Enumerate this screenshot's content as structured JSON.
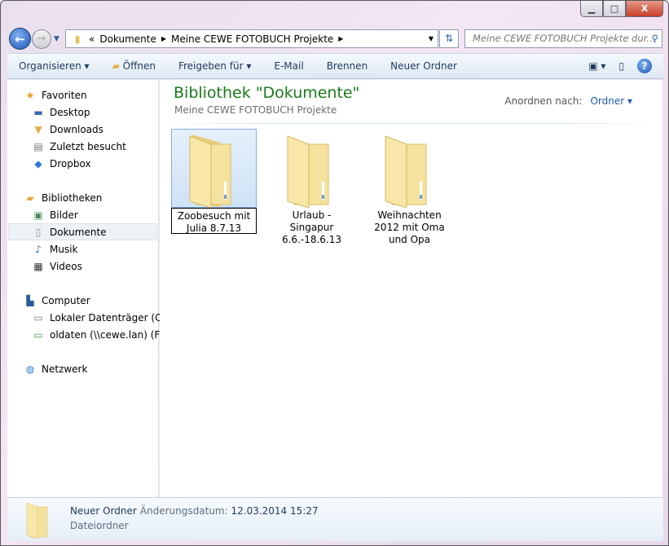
{
  "window": {
    "minimize": "▁",
    "maximize": "□",
    "close": "X"
  },
  "address": {
    "chevrons": "«",
    "crumbs": [
      "Dokumente",
      "Meine CEWE FOTOBUCH Projekte"
    ],
    "search_placeholder": "Meine CEWE FOTOBUCH Projekte dur..."
  },
  "toolbar": {
    "organize": "Organisieren",
    "open": "Öffnen",
    "share": "Freigeben für",
    "email": "E-Mail",
    "burn": "Brennen",
    "new_folder": "Neuer Ordner"
  },
  "sidebar": {
    "favorites": {
      "label": "Favoriten",
      "items": [
        "Desktop",
        "Downloads",
        "Zuletzt besucht",
        "Dropbox"
      ]
    },
    "libraries": {
      "label": "Bibliotheken",
      "items": [
        "Bilder",
        "Dokumente",
        "Musik",
        "Videos"
      ]
    },
    "computer": {
      "label": "Computer",
      "items": [
        "Lokaler Datenträger (C:)",
        "oldaten (\\\\cewe.lan) (F:)"
      ]
    },
    "network": {
      "label": "Netzwerk"
    }
  },
  "main": {
    "title": "Bibliothek \"Dokumente\"",
    "subtitle": "Meine CEWE FOTOBUCH Projekte",
    "arrange_label": "Anordnen nach:",
    "arrange_value": "Ordner",
    "items": [
      {
        "name": "Zoobesuch mit Julia 8.7.13"
      },
      {
        "name": "Urlaub - Singapur 6.6.-18.6.13"
      },
      {
        "name": "Weihnachten 2012 mit Oma und Opa"
      }
    ]
  },
  "details": {
    "name": "Neuer Ordner",
    "modified_label": "Änderungsdatum:",
    "modified": "12.03.2014 15:27",
    "type": "Dateiordner"
  }
}
